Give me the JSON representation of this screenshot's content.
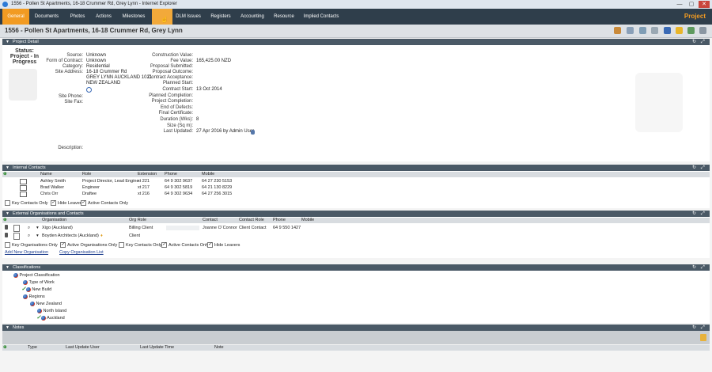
{
  "window": {
    "title": "1556 - Pollen St Apartments, 16-18 Crummer Rd, Grey Lynn - Internet Explorer",
    "min": "—",
    "max": "▢",
    "close": "✕"
  },
  "nav": {
    "tabs": [
      "General",
      "Documents",
      "Photos",
      "Actions",
      "Milestones",
      "",
      "DLM Issues",
      "Registers",
      "Accounting",
      "Resource",
      "Implied Contacts"
    ],
    "brand": "Project"
  },
  "project": {
    "title": "1556 - Pollen St Apartments, 16-18 Crummer Rd, Grey Lynn"
  },
  "detail": {
    "header": "Project Detail",
    "status_label": "Status:",
    "status_value": "Project - In Progress",
    "left_fields": [
      {
        "label": "Source:",
        "value": "Unknown"
      },
      {
        "label": "Form of Contract:",
        "value": "Unknown"
      },
      {
        "label": "Category:",
        "value": "Residential"
      },
      {
        "label": "Site Address:",
        "value": "16-18 Crummer Rd"
      },
      {
        "label": "",
        "value": "GREY LYNN AUCKLAND 1021"
      },
      {
        "label": "",
        "value": "NEW ZEALAND"
      },
      {
        "label": "Site Phone:",
        "value": ""
      },
      {
        "label": "Site Fax:",
        "value": ""
      }
    ],
    "description_label": "Description:",
    "right_fields": [
      {
        "label": "Construction Value:",
        "value": ""
      },
      {
        "label": "Fee Value:",
        "value": "165,425.00 NZD"
      },
      {
        "label": "Proposal Submitted:",
        "value": ""
      },
      {
        "label": "Proposal Outcome:",
        "value": ""
      },
      {
        "label": "Contract Acceptance:",
        "value": ""
      },
      {
        "label": "Planned Start:",
        "value": ""
      },
      {
        "label": "Contract Start:",
        "value": "13 Oct 2014"
      },
      {
        "label": "Planned Completion:",
        "value": ""
      },
      {
        "label": "Project Completion:",
        "value": ""
      },
      {
        "label": "End of Defects:",
        "value": ""
      },
      {
        "label": "Final Certificate:",
        "value": ""
      },
      {
        "label": "Duration (Wks):",
        "value": "8"
      },
      {
        "label": "Size (Sq m):",
        "value": ""
      },
      {
        "label": "Last Updated:",
        "value": "27 Apr 2016 by Admin User"
      }
    ]
  },
  "internal": {
    "header": "Internal Contacts",
    "columns": [
      "Name",
      "Role",
      "Extension",
      "Phone",
      "Mobile"
    ],
    "rows": [
      [
        "Ashley Smith",
        "Project Director, Lead Engine",
        "xt 221",
        "64 9 302 9637",
        "64 27 230 5153"
      ],
      [
        "Brad Walker",
        "Engineer",
        "xt 217",
        "64 9 302 5819",
        "64 21 130 8229"
      ],
      [
        "Chris Orr",
        "Draftee",
        "xt 216",
        "64 9 302 9634",
        "64 27 256 3015"
      ]
    ],
    "checks": [
      "Key Contacts Only",
      "Hide Leavers",
      "Active Contacts Only"
    ]
  },
  "external": {
    "header": "External Organisations and Contacts",
    "columns": [
      "Organisation",
      "Org Role",
      "Contact",
      "Contact Role",
      "Phone",
      "Mobile"
    ],
    "rows": [
      [
        "Xigo (Auckland)",
        "Billing Client",
        "Joanne O`Connor",
        "Client Contact",
        "64 9 550 1427",
        ""
      ],
      [
        "Boyden Architects (Auckland)",
        "Client",
        "",
        "",
        "",
        ""
      ]
    ],
    "checks": [
      "Key Organisations Only",
      "Active Organisations Only",
      "Key Contacts Only",
      "Active Contacts Only",
      "Hide Leavers"
    ],
    "links": [
      "Add New Organisation",
      "Copy Organisation List"
    ]
  },
  "classifications": {
    "header": "Classifications",
    "tree": [
      "Project Classification",
      "Type of Work",
      "New Build",
      "Regions",
      "New Zealand",
      "North Island",
      "Auckland"
    ]
  },
  "notes": {
    "header": "Notes",
    "columns": [
      "Type",
      "Last Update User",
      "Last Update Time",
      "Note"
    ]
  },
  "colors": {
    "nav_bg": "#2f3e4b",
    "accent": "#f29b22",
    "section_bg": "#4a5966"
  }
}
